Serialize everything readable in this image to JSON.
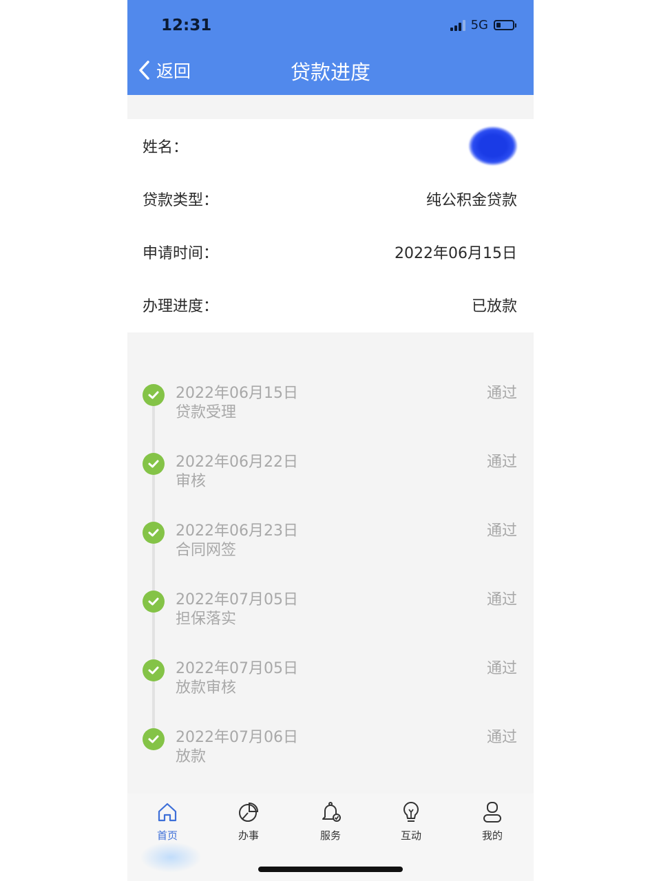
{
  "status_bar": {
    "time": "12:31",
    "network": "5G"
  },
  "header": {
    "back_label": "返回",
    "title": "贷款进度"
  },
  "info": [
    {
      "label": "姓名：",
      "value": ""
    },
    {
      "label": "贷款类型：",
      "value": "纯公积金贷款"
    },
    {
      "label": "申请时间：",
      "value": "2022年06月15日"
    },
    {
      "label": "办理进度：",
      "value": "已放款"
    }
  ],
  "timeline": [
    {
      "date": "2022年06月15日",
      "step": "贷款受理",
      "status": "通过"
    },
    {
      "date": "2022年06月22日",
      "step": "审核",
      "status": "通过"
    },
    {
      "date": "2022年06月23日",
      "step": "合同网签",
      "status": "通过"
    },
    {
      "date": "2022年07月05日",
      "step": "担保落实",
      "status": "通过"
    },
    {
      "date": "2022年07月05日",
      "step": "放款审核",
      "status": "通过"
    },
    {
      "date": "2022年07月06日",
      "step": "放款",
      "status": "通过"
    }
  ],
  "tabs": [
    {
      "label": "首页",
      "icon": "home-icon"
    },
    {
      "label": "办事",
      "icon": "pie-chart-icon"
    },
    {
      "label": "服务",
      "icon": "bell-check-icon"
    },
    {
      "label": "互动",
      "icon": "lightbulb-icon"
    },
    {
      "label": "我的",
      "icon": "user-icon"
    }
  ],
  "colors": {
    "header": "#5189ec",
    "check": "#84c347",
    "active_tab": "#3d6fd8"
  }
}
